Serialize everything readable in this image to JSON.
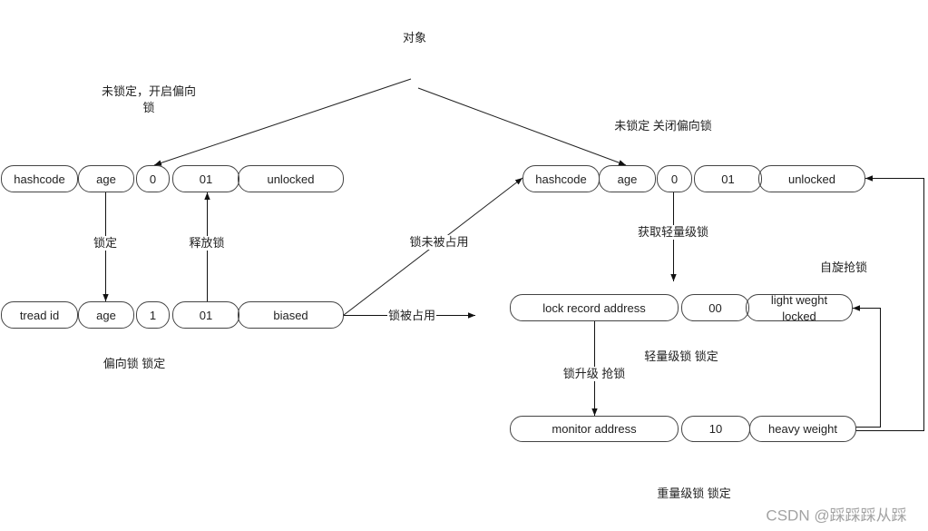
{
  "diagram": {
    "title": "对象",
    "state_labels": {
      "biasable_unlocked_line1": "未锁定，开启偏向",
      "biasable_unlocked_line2": "锁",
      "nonbiasable_unlocked": "未锁定 关闭偏向锁",
      "biased_locked": "偏向锁 锁定",
      "lightweight_locked": "轻量级锁 锁定",
      "heavyweight_locked": "重量级锁 锁定",
      "spin_acquire": "自旋抢锁"
    },
    "edge_labels": {
      "lock": "锁定",
      "release": "释放锁",
      "lock_not_occupied": "锁未被占用",
      "lock_occupied": "锁被占用",
      "acquire_lightweight": "获取轻量级锁",
      "upgrade_contend": "锁升级 抢锁"
    },
    "rows": {
      "biasable_unlocked": [
        "hashcode",
        "age",
        "0",
        "01",
        "unlocked"
      ],
      "biased": [
        "tread id",
        "age",
        "1",
        "01",
        "biased"
      ],
      "nonbiasable_unlocked": [
        "hashcode",
        "age",
        "0",
        "01",
        "unlocked"
      ],
      "lightweight": [
        "lock record address",
        "00"
      ],
      "lightweight_state": [
        "light weght",
        "locked"
      ],
      "heavyweight": [
        "monitor address",
        "10",
        "heavy weight"
      ]
    }
  },
  "watermark": "CSDN @踩踩踩从踩",
  "colors": {
    "line": "#111111",
    "box_border": "#444444",
    "text": "#222222",
    "watermark": "#a3a3a3"
  }
}
